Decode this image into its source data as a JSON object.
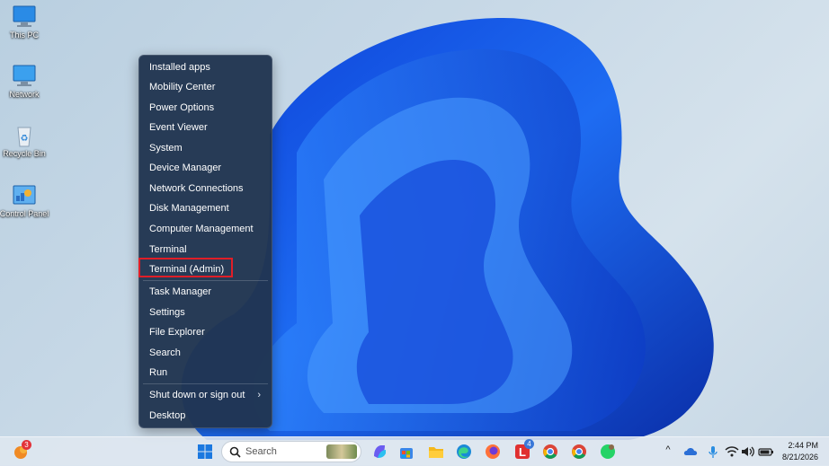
{
  "desktop": {
    "icons": [
      {
        "label": "This PC",
        "icon": "this-pc-icon"
      },
      {
        "label": "Network",
        "icon": "network-icon"
      },
      {
        "label": "Recycle Bin",
        "icon": "recycle-bin-icon"
      },
      {
        "label": "Control Panel",
        "icon": "control-panel-icon"
      }
    ]
  },
  "context_menu": {
    "items": [
      "Installed apps",
      "Mobility Center",
      "Power Options",
      "Event Viewer",
      "System",
      "Device Manager",
      "Network Connections",
      "Disk Management",
      "Computer Management",
      "Terminal",
      "Terminal (Admin)",
      "Task Manager",
      "Settings",
      "File Explorer",
      "Search",
      "Run",
      "Shut down or sign out",
      "Desktop"
    ],
    "highlighted_item": "Terminal (Admin)",
    "submenu_arrow": "›",
    "highlight_color": "#e01e27"
  },
  "taskbar": {
    "search_placeholder": "Search",
    "weather_badge": "3",
    "store_badge": "4",
    "time": "2:44 PM",
    "date": "8/21/2026",
    "tray_chevron": "^",
    "app_icons": [
      "start-icon",
      "copilot-icon",
      "store-icon",
      "file-explorer-icon",
      "edge-icon",
      "firefox-icon",
      "app-l-icon",
      "chrome-icon",
      "chrome-alt-icon",
      "whatsapp-icon"
    ]
  }
}
